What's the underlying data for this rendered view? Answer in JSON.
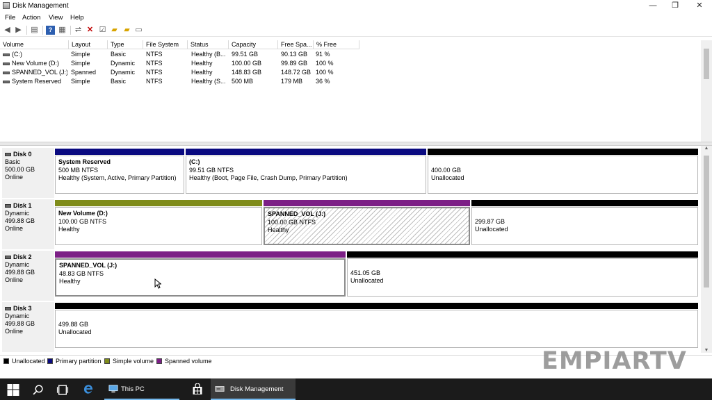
{
  "window": {
    "title": "Disk Management",
    "controls": {
      "minimize": "—",
      "restore": "❐",
      "close": "✕"
    }
  },
  "menu": [
    "File",
    "Action",
    "View",
    "Help"
  ],
  "volume_table": {
    "columns": [
      "Volume",
      "Layout",
      "Type",
      "File System",
      "Status",
      "Capacity",
      "Free Spa...",
      "% Free"
    ],
    "rows": [
      [
        "(C:)",
        "Simple",
        "Basic",
        "NTFS",
        "Healthy (B...",
        "99.51 GB",
        "90.13 GB",
        "91 %"
      ],
      [
        "New Volume (D:)",
        "Simple",
        "Dynamic",
        "NTFS",
        "Healthy",
        "100.00 GB",
        "99.89 GB",
        "100 %"
      ],
      [
        "SPANNED_VOL (J:)",
        "Spanned",
        "Dynamic",
        "NTFS",
        "Healthy",
        "148.83 GB",
        "148.72 GB",
        "100 %"
      ],
      [
        "System Reserved",
        "Simple",
        "Basic",
        "NTFS",
        "Healthy (S...",
        "500 MB",
        "179 MB",
        "36 %"
      ]
    ]
  },
  "disks": [
    {
      "name": "Disk 0",
      "type": "Basic",
      "size": "500.00 GB",
      "status": "Online",
      "partitions": [
        {
          "name": "System Reserved",
          "size": "500 MB NTFS",
          "status": "Healthy (System, Active, Primary Partition)",
          "kind": "primary"
        },
        {
          "name": "(C:)",
          "size": "99.51 GB NTFS",
          "status": "Healthy (Boot, Page File, Crash Dump, Primary Partition)",
          "kind": "primary"
        },
        {
          "name": "",
          "size": "400.00 GB",
          "status": "Unallocated",
          "kind": "unallocated"
        }
      ]
    },
    {
      "name": "Disk 1",
      "type": "Dynamic",
      "size": "499.88 GB",
      "status": "Online",
      "partitions": [
        {
          "name": "New Volume  (D:)",
          "size": "100.00 GB NTFS",
          "status": "Healthy",
          "kind": "simple"
        },
        {
          "name": "SPANNED_VOL  (J:)",
          "size": "100.00 GB NTFS",
          "status": "Healthy",
          "kind": "spanned"
        },
        {
          "name": "",
          "size": "299.87 GB",
          "status": "Unallocated",
          "kind": "unallocated"
        }
      ]
    },
    {
      "name": "Disk 2",
      "type": "Dynamic",
      "size": "499.88 GB",
      "status": "Online",
      "partitions": [
        {
          "name": "SPANNED_VOL  (J:)",
          "size": "48.83 GB NTFS",
          "status": "Healthy",
          "kind": "spanned"
        },
        {
          "name": "",
          "size": "451.05 GB",
          "status": "Unallocated",
          "kind": "unallocated"
        }
      ]
    },
    {
      "name": "Disk 3",
      "type": "Dynamic",
      "size": "499.88 GB",
      "status": "Online",
      "partitions": [
        {
          "name": "",
          "size": "499.88 GB",
          "status": "Unallocated",
          "kind": "unallocated"
        }
      ]
    }
  ],
  "legend": [
    {
      "label": "Unallocated",
      "color": "#000000"
    },
    {
      "label": "Primary partition",
      "color": "#0a0a80"
    },
    {
      "label": "Simple volume",
      "color": "#7f8c1a"
    },
    {
      "label": "Spanned volume",
      "color": "#7c1f86"
    }
  ],
  "watermark": "EMPIARTV",
  "taskbar": {
    "apps": [
      {
        "label": "This PC",
        "icon": "this-pc-icon"
      },
      {
        "label": "Disk Management",
        "icon": "disk-management-icon"
      }
    ]
  },
  "colors": {
    "primary": "#0a0a80",
    "simple": "#7f8c1a",
    "spanned": "#7c1f86",
    "unallocated": "#000000",
    "taskbar": "#1b1b1b",
    "accent": "#76b9ed"
  }
}
